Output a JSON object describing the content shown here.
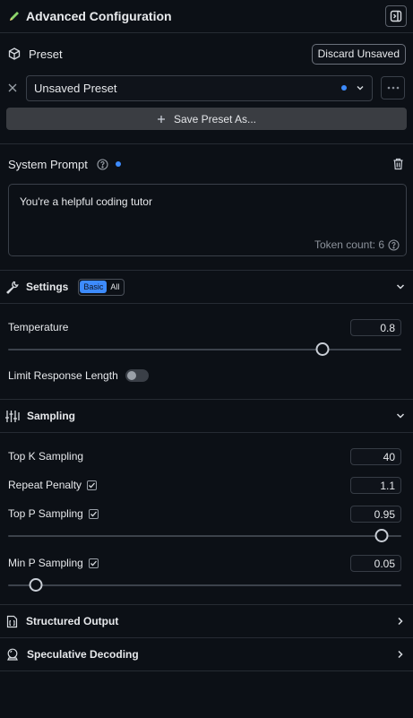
{
  "header": {
    "title": "Advanced Configuration"
  },
  "preset": {
    "label": "Preset",
    "discard_label": "Discard Unsaved",
    "selected": "Unsaved Preset",
    "save_label": "Save Preset As..."
  },
  "system_prompt": {
    "label": "System Prompt",
    "text": "You're a helpful coding tutor",
    "token_count": "Token count: 6"
  },
  "settings": {
    "title": "Settings",
    "mode_basic": "Basic",
    "mode_all": "All",
    "temperature": {
      "label": "Temperature",
      "value": "0.8",
      "fraction": 0.8
    },
    "limit_label": "Limit Response Length"
  },
  "sampling": {
    "title": "Sampling",
    "top_k": {
      "label": "Top K Sampling",
      "value": "40"
    },
    "repeat_penalty": {
      "label": "Repeat Penalty",
      "value": "1.1"
    },
    "top_p": {
      "label": "Top P Sampling",
      "value": "0.95",
      "fraction": 0.95
    },
    "min_p": {
      "label": "Min P Sampling",
      "value": "0.05",
      "fraction": 0.07
    }
  },
  "structured_output": {
    "title": "Structured Output"
  },
  "speculative_decoding": {
    "title": "Speculative Decoding"
  },
  "colors": {
    "accent": "#3d8bfd",
    "background": "#0c1016"
  }
}
